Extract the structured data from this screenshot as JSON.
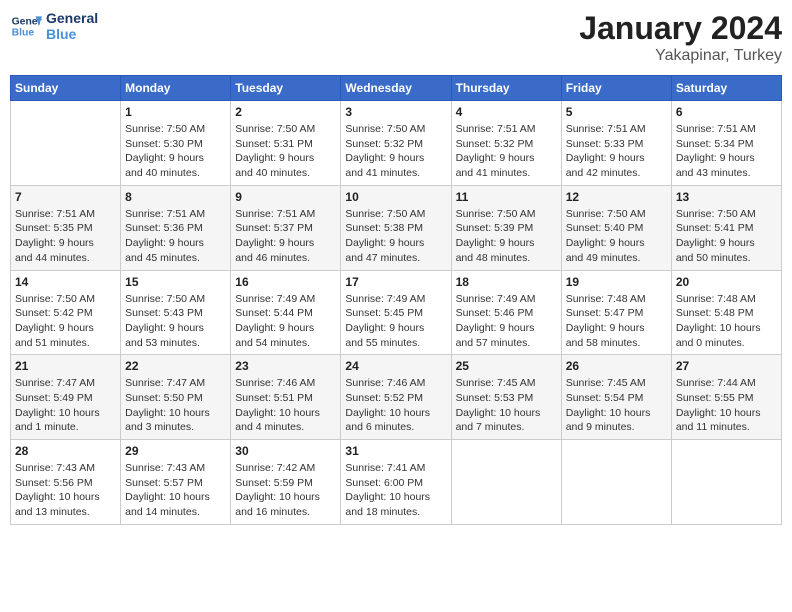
{
  "header": {
    "logo_line1": "General",
    "logo_line2": "Blue",
    "month": "January 2024",
    "location": "Yakapinar, Turkey"
  },
  "days_of_week": [
    "Sunday",
    "Monday",
    "Tuesday",
    "Wednesday",
    "Thursday",
    "Friday",
    "Saturday"
  ],
  "weeks": [
    [
      {
        "day": "",
        "info": ""
      },
      {
        "day": "1",
        "info": "Sunrise: 7:50 AM\nSunset: 5:30 PM\nDaylight: 9 hours\nand 40 minutes."
      },
      {
        "day": "2",
        "info": "Sunrise: 7:50 AM\nSunset: 5:31 PM\nDaylight: 9 hours\nand 40 minutes."
      },
      {
        "day": "3",
        "info": "Sunrise: 7:50 AM\nSunset: 5:32 PM\nDaylight: 9 hours\nand 41 minutes."
      },
      {
        "day": "4",
        "info": "Sunrise: 7:51 AM\nSunset: 5:32 PM\nDaylight: 9 hours\nand 41 minutes."
      },
      {
        "day": "5",
        "info": "Sunrise: 7:51 AM\nSunset: 5:33 PM\nDaylight: 9 hours\nand 42 minutes."
      },
      {
        "day": "6",
        "info": "Sunrise: 7:51 AM\nSunset: 5:34 PM\nDaylight: 9 hours\nand 43 minutes."
      }
    ],
    [
      {
        "day": "7",
        "info": "Sunrise: 7:51 AM\nSunset: 5:35 PM\nDaylight: 9 hours\nand 44 minutes."
      },
      {
        "day": "8",
        "info": "Sunrise: 7:51 AM\nSunset: 5:36 PM\nDaylight: 9 hours\nand 45 minutes."
      },
      {
        "day": "9",
        "info": "Sunrise: 7:51 AM\nSunset: 5:37 PM\nDaylight: 9 hours\nand 46 minutes."
      },
      {
        "day": "10",
        "info": "Sunrise: 7:50 AM\nSunset: 5:38 PM\nDaylight: 9 hours\nand 47 minutes."
      },
      {
        "day": "11",
        "info": "Sunrise: 7:50 AM\nSunset: 5:39 PM\nDaylight: 9 hours\nand 48 minutes."
      },
      {
        "day": "12",
        "info": "Sunrise: 7:50 AM\nSunset: 5:40 PM\nDaylight: 9 hours\nand 49 minutes."
      },
      {
        "day": "13",
        "info": "Sunrise: 7:50 AM\nSunset: 5:41 PM\nDaylight: 9 hours\nand 50 minutes."
      }
    ],
    [
      {
        "day": "14",
        "info": "Sunrise: 7:50 AM\nSunset: 5:42 PM\nDaylight: 9 hours\nand 51 minutes."
      },
      {
        "day": "15",
        "info": "Sunrise: 7:50 AM\nSunset: 5:43 PM\nDaylight: 9 hours\nand 53 minutes."
      },
      {
        "day": "16",
        "info": "Sunrise: 7:49 AM\nSunset: 5:44 PM\nDaylight: 9 hours\nand 54 minutes."
      },
      {
        "day": "17",
        "info": "Sunrise: 7:49 AM\nSunset: 5:45 PM\nDaylight: 9 hours\nand 55 minutes."
      },
      {
        "day": "18",
        "info": "Sunrise: 7:49 AM\nSunset: 5:46 PM\nDaylight: 9 hours\nand 57 minutes."
      },
      {
        "day": "19",
        "info": "Sunrise: 7:48 AM\nSunset: 5:47 PM\nDaylight: 9 hours\nand 58 minutes."
      },
      {
        "day": "20",
        "info": "Sunrise: 7:48 AM\nSunset: 5:48 PM\nDaylight: 10 hours\nand 0 minutes."
      }
    ],
    [
      {
        "day": "21",
        "info": "Sunrise: 7:47 AM\nSunset: 5:49 PM\nDaylight: 10 hours\nand 1 minute."
      },
      {
        "day": "22",
        "info": "Sunrise: 7:47 AM\nSunset: 5:50 PM\nDaylight: 10 hours\nand 3 minutes."
      },
      {
        "day": "23",
        "info": "Sunrise: 7:46 AM\nSunset: 5:51 PM\nDaylight: 10 hours\nand 4 minutes."
      },
      {
        "day": "24",
        "info": "Sunrise: 7:46 AM\nSunset: 5:52 PM\nDaylight: 10 hours\nand 6 minutes."
      },
      {
        "day": "25",
        "info": "Sunrise: 7:45 AM\nSunset: 5:53 PM\nDaylight: 10 hours\nand 7 minutes."
      },
      {
        "day": "26",
        "info": "Sunrise: 7:45 AM\nSunset: 5:54 PM\nDaylight: 10 hours\nand 9 minutes."
      },
      {
        "day": "27",
        "info": "Sunrise: 7:44 AM\nSunset: 5:55 PM\nDaylight: 10 hours\nand 11 minutes."
      }
    ],
    [
      {
        "day": "28",
        "info": "Sunrise: 7:43 AM\nSunset: 5:56 PM\nDaylight: 10 hours\nand 13 minutes."
      },
      {
        "day": "29",
        "info": "Sunrise: 7:43 AM\nSunset: 5:57 PM\nDaylight: 10 hours\nand 14 minutes."
      },
      {
        "day": "30",
        "info": "Sunrise: 7:42 AM\nSunset: 5:59 PM\nDaylight: 10 hours\nand 16 minutes."
      },
      {
        "day": "31",
        "info": "Sunrise: 7:41 AM\nSunset: 6:00 PM\nDaylight: 10 hours\nand 18 minutes."
      },
      {
        "day": "",
        "info": ""
      },
      {
        "day": "",
        "info": ""
      },
      {
        "day": "",
        "info": ""
      }
    ]
  ]
}
